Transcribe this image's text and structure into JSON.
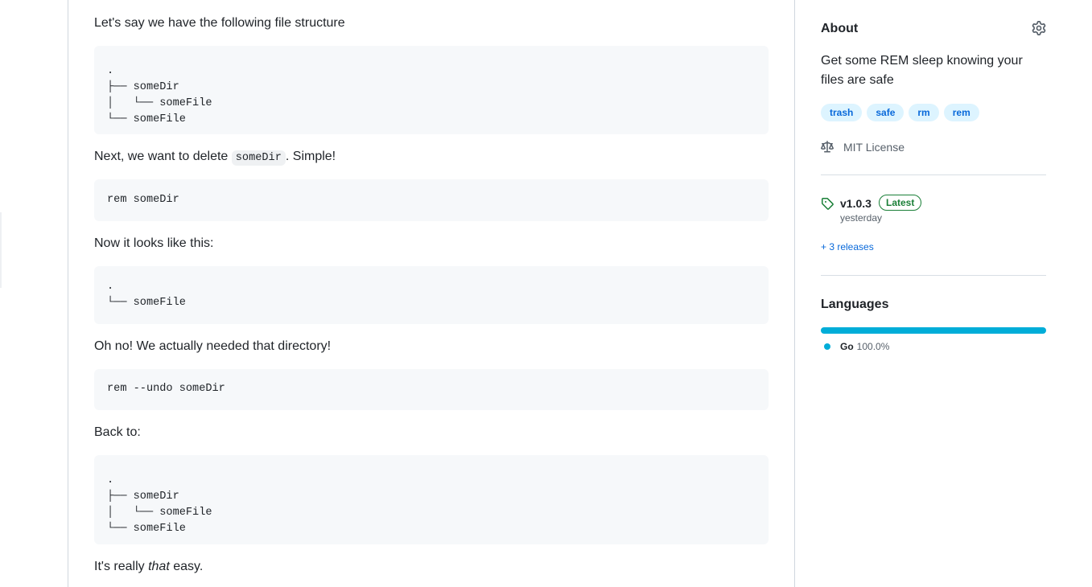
{
  "readme": {
    "p_structure": "Let's say we have the following file structure",
    "tree1": [
      ".",
      "├── someDir",
      "│   └── someFile",
      "└── someFile"
    ],
    "p_next_before": "Next, we want to delete ",
    "p_next_code": "someDir",
    "p_next_after": ". Simple!",
    "cmd_rem": "rem someDir",
    "p_now": "Now it looks like this:",
    "tree2": [
      ".",
      "└── someFile"
    ],
    "p_ohno": "Oh no! We actually needed that directory!",
    "cmd_undo": "rem --undo someDir",
    "p_back": "Back to:",
    "tree3": [
      ".",
      "├── someDir",
      "│   └── someFile",
      "└── someFile"
    ],
    "p_easy_before": "It's really ",
    "p_easy_em": "that",
    "p_easy_after": " easy."
  },
  "sidebar": {
    "about_title": "About",
    "gear_icon": "gear-icon",
    "description": "Get some REM sleep knowing your files are safe",
    "topics": [
      "trash",
      "safe",
      "rm",
      "rem"
    ],
    "license_icon": "law-icon",
    "license": "MIT License",
    "release_icon": "tag-icon",
    "release_version": "v1.0.3",
    "release_badge": "Latest",
    "release_date": "yesterday",
    "more_releases": "+ 3 releases",
    "languages_title": "Languages",
    "languages": [
      {
        "name": "Go",
        "percent": "100.0%",
        "fraction": 1.0,
        "color": "#00ADD8"
      }
    ]
  }
}
